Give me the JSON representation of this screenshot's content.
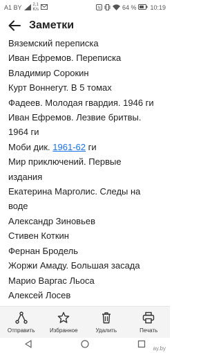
{
  "status_bar": {
    "carrier": "A1 BY",
    "speed_value": "2,1",
    "speed_unit": "K/s",
    "battery": "64 %",
    "time": "10:19"
  },
  "app_bar": {
    "title": "Заметки"
  },
  "note": {
    "lines": [
      "Вяземский переписка",
      "Иван Ефремов. Переписка",
      "Владимир Сорокин",
      "Курт Воннегут. В 5 томах",
      "Фадеев. Молодая гвардия. 1946 ги",
      "Иван Ефремов. Лезвие бритвы.",
      "1964 ги",
      "",
      "Мир приключений. Первые",
      "издания",
      "Екатерина Марголис. Следы на",
      "воде",
      "Александр Зиновьев",
      "Стивен Коткин",
      "Фернан Бродель",
      "Жоржи Амаду. Большая засада",
      "Марио Варгас Льоса",
      "Алексей Лосев"
    ],
    "link_line": {
      "before": "Моби дик. ",
      "link": "1961-62",
      "after": " ги"
    }
  },
  "actions": {
    "send": "Отправить",
    "favorites": "Избранное",
    "delete": "Удалить",
    "print": "Печать"
  },
  "watermark": "ay.by"
}
